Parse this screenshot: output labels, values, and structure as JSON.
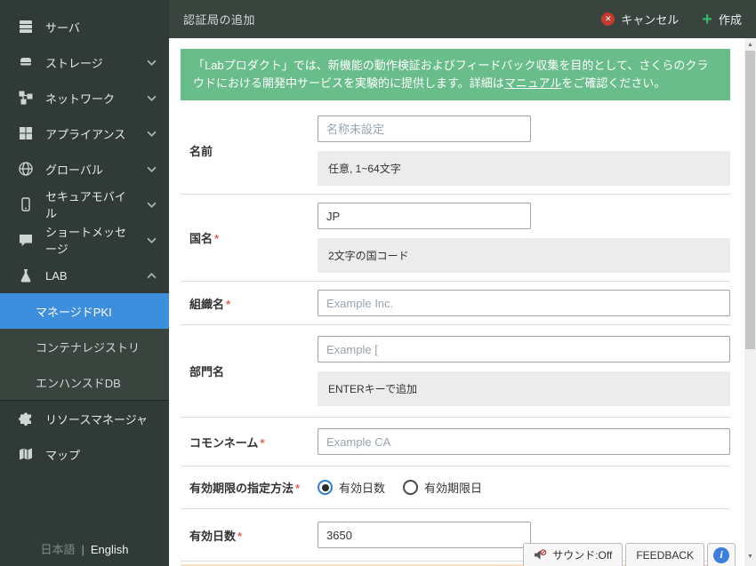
{
  "colors": {
    "sidebar_bg": "#303b37",
    "submenu_bg": "#39443e",
    "selected_blue": "#3e8ede",
    "topbar_bg": "#39443f",
    "banner_green": "#69bd8b",
    "cancel_red": "#c23b2e",
    "create_green": "#35b568",
    "radio_blue": "#2e7cd6",
    "required_red": "#e0635c",
    "hint_bg": "#ececec",
    "partial_row_tan": "#f7e3c3"
  },
  "sidebar": {
    "items": [
      {
        "label": "サーバ",
        "icon": "server-icon"
      },
      {
        "label": "ストレージ",
        "icon": "storage-icon",
        "chevron": "down"
      },
      {
        "label": "ネットワーク",
        "icon": "network-icon",
        "chevron": "down"
      },
      {
        "label": "アプライアンス",
        "icon": "appliance-icon",
        "chevron": "down"
      },
      {
        "label": "グローバル",
        "icon": "globe-icon",
        "chevron": "down"
      },
      {
        "label": "セキュアモバイル",
        "icon": "mobile-icon",
        "chevron": "down"
      },
      {
        "label": "ショートメッセージ",
        "icon": "message-icon",
        "chevron": "down"
      },
      {
        "label": "LAB",
        "icon": "flask-icon",
        "chevron": "up"
      }
    ],
    "submenu": [
      {
        "label": "マネージドPKI",
        "selected": true
      },
      {
        "label": "コンテナレジストリ",
        "selected": false
      },
      {
        "label": "エンハンスドDB",
        "selected": false
      }
    ],
    "bottom_items": [
      {
        "label": "リソースマネージャ",
        "icon": "puzzle-icon"
      },
      {
        "label": "マップ",
        "icon": "map-icon"
      }
    ],
    "language": {
      "japanese": "日本語",
      "divider": "|",
      "english": "English"
    }
  },
  "header": {
    "title": "認証局の追加",
    "cancel_label": "キャンセル",
    "create_label": "作成"
  },
  "banner": {
    "text_before_link": "「Labプロダクト」では、新機能の動作検証およびフィードバック収集を目的として、さくらのクラウドにおける開発中サービスを実験的に提供します。詳細は",
    "link_text": "マニュアル",
    "text_after_link": "をご確認ください。"
  },
  "form": {
    "required_mark": "*",
    "rows": [
      {
        "label": "名前",
        "required": false,
        "input": {
          "placeholder": "名称未設定"
        },
        "hint": "任意, 1~64文字"
      },
      {
        "label": "国名",
        "required": true,
        "input": {
          "value": "JP"
        },
        "hint": "2文字の国コード"
      },
      {
        "label": "組織名",
        "required": true,
        "input": {
          "placeholder": "Example Inc."
        }
      },
      {
        "label": "部門名",
        "required": false,
        "input": {
          "placeholder": "Example ["
        },
        "hint": "ENTERキーで追加"
      },
      {
        "label": "コモンネーム",
        "required": true,
        "input": {
          "placeholder": "Example CA"
        }
      },
      {
        "label": "有効期限の指定方法",
        "required": true,
        "radios": [
          {
            "label": "有効日数",
            "checked": true
          },
          {
            "label": "有効期限日",
            "checked": false
          }
        ]
      },
      {
        "label": "有効日数",
        "required": true,
        "input": {
          "value": "3650"
        }
      }
    ]
  },
  "footer_buttons": {
    "sound_label": "サウンド:Off",
    "feedback_label": "FEEDBACK",
    "help_label": "i"
  },
  "icons": {
    "scroll_up": "▲",
    "scroll_down": "▼",
    "cancel_x": "✕",
    "create_plus": "+"
  }
}
